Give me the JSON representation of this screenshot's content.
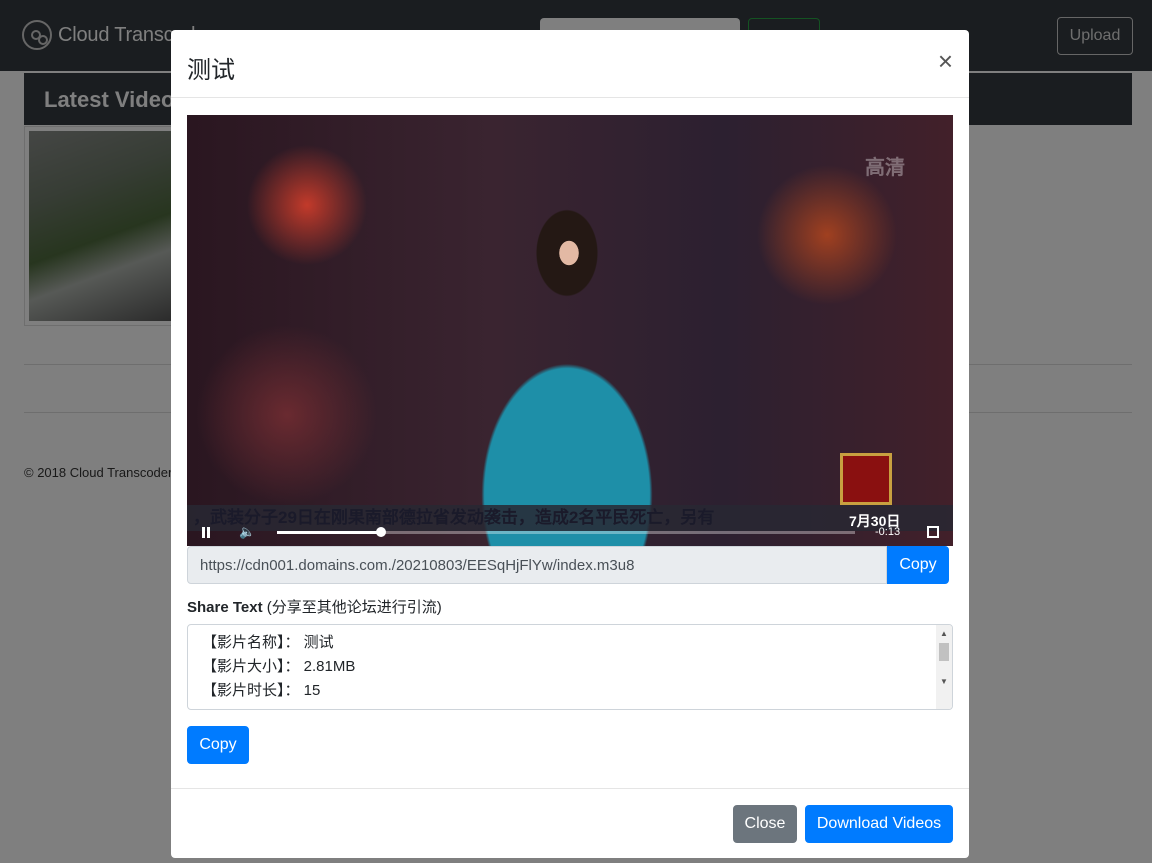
{
  "navbar": {
    "brand": "Cloud Transcoder",
    "upload_label": "Upload"
  },
  "main": {
    "header": "Latest Videos",
    "footer": "© 2018 Cloud Transcoder"
  },
  "modal": {
    "title": "测试",
    "close_symbol": "×",
    "video": {
      "overlay_tag": "高清",
      "subtitle": "，武装分子29日在刚果南部德拉省发动袭击，造成2名平民死亡，另有",
      "date": "7月30日",
      "time_remaining": "-0:13",
      "progress": 0.18,
      "icons": [
        "pause-icon",
        "volume-icon",
        "fullscreen-icon"
      ]
    },
    "url": {
      "value": "https://cdn001.domains.com./20210803/EESqHjFlYw/index.m3u8",
      "copy_label": "Copy"
    },
    "share": {
      "label_bold": "Share Text",
      "label_note": "(分享至其他论坛进行引流)",
      "lines": [
        "【影片名称】： 测试",
        "【影片大小】： 2.81MB",
        "【影片时长】： 15"
      ],
      "copy_label": "Copy"
    },
    "footer": {
      "close_label": "Close",
      "download_label": "Download Videos"
    }
  },
  "colors": {
    "primary": "#007bff",
    "secondary": "#6c757d",
    "navbar": "#343a40"
  }
}
